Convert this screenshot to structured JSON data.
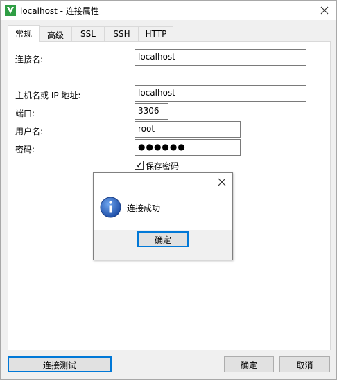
{
  "window": {
    "title": "localhost - 连接属性"
  },
  "tabs": [
    {
      "label": "常规",
      "active": true
    },
    {
      "label": "高级"
    },
    {
      "label": "SSL"
    },
    {
      "label": "SSH"
    },
    {
      "label": "HTTP"
    }
  ],
  "general": {
    "connection_name_label": "连接名:",
    "connection_name_value": "localhost",
    "host_label": "主机名或 IP 地址:",
    "host_value": "localhost",
    "port_label": "端口:",
    "port_value": "3306",
    "user_label": "用户名:",
    "user_value": "root",
    "password_label": "密码:",
    "password_value": "●●●●●●",
    "save_password_label": "保存密码",
    "save_password_checked": true
  },
  "message_box": {
    "text": "连接成功",
    "ok_label": "确定",
    "icon": "info-icon"
  },
  "footer": {
    "test_label": "连接测试",
    "ok_label": "确定",
    "cancel_label": "取消"
  },
  "colors": {
    "accent": "#0078d7",
    "app_icon_green": "#2f9e44",
    "info_blue": "#1f63c8"
  }
}
